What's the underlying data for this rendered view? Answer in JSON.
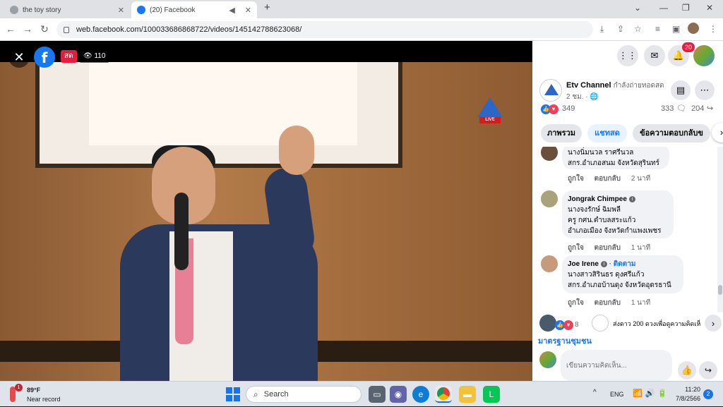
{
  "browser": {
    "tabs": [
      {
        "label": "the toy story",
        "active": false
      },
      {
        "label": "(20) Facebook",
        "active": true
      }
    ],
    "new_tab": "+",
    "url": "web.facebook.com/100033686868722/videos/145142788623068/",
    "window_controls": {
      "dropdown": "⌄",
      "minimize": "—",
      "restore": "❐",
      "close": "✕"
    }
  },
  "video": {
    "live_label": "สด",
    "viewer_count": "110",
    "channel_badge": "LIVE"
  },
  "topnav": {
    "notification_count": "20"
  },
  "post": {
    "page_name": "Etv Channel",
    "status": "กำลังถ่ายทอดสด",
    "time": "2 ชม. ·",
    "reaction_count": "349",
    "comment_count": "333",
    "share_count": "204"
  },
  "tabs": [
    {
      "label": "ภาพรวม",
      "active": false
    },
    {
      "label": "แชทสด",
      "active": true
    },
    {
      "label": "ข้อความตอบกลับข",
      "active": false
    }
  ],
  "comments": [
    {
      "author": "",
      "lines": [
        "นางนิ่มนวล ราศรีนวล",
        "สกร.อำเภอสนม จังหวัดสุรินทร์"
      ],
      "like": "ถูกใจ",
      "reply": "ตอบกลับ",
      "time": "2 นาที"
    },
    {
      "author": "Jongrak Chimpee",
      "lines": [
        "นางจงรักษ์ ฉิมพลี",
        "ครู กศน.ตำบลสระแก้ว",
        "อำเภอเมือง จังหวัดกำแพงเพชร"
      ],
      "like": "ถูกใจ",
      "reply": "ตอบกลับ",
      "time": "1 นาที"
    },
    {
      "author": "Joe Irene",
      "follow": "· ติดตาม",
      "lines": [
        "นางสาวสิรินธร ดุงศรีแก้ว",
        "สกร.อำเภอบ้านดุง จังหวัดอุดรธานี"
      ],
      "like": "ถูกใจ",
      "reply": "ตอบกลับ",
      "time": "1 นาที"
    }
  ],
  "share_strip": {
    "reaction_count": "8",
    "text": "ส่งดาว 200 ดวงเพื่อดูความคิดเห็"
  },
  "video_title": "มาตรฐานชุมชน",
  "composer": {
    "placeholder": "เขียนความคิดเห็น..."
  },
  "taskbar": {
    "weather_alert": "1",
    "temperature": "89°F",
    "condition": "Near record",
    "search_label": "Search",
    "language": "ENG",
    "time": "11:20",
    "date": "7/8/2566",
    "notification_count": "2"
  },
  "colors": {
    "facebook_blue": "#1877f2",
    "live_red": "#e41e3f",
    "comment_bubble": "#f0f2f5"
  }
}
